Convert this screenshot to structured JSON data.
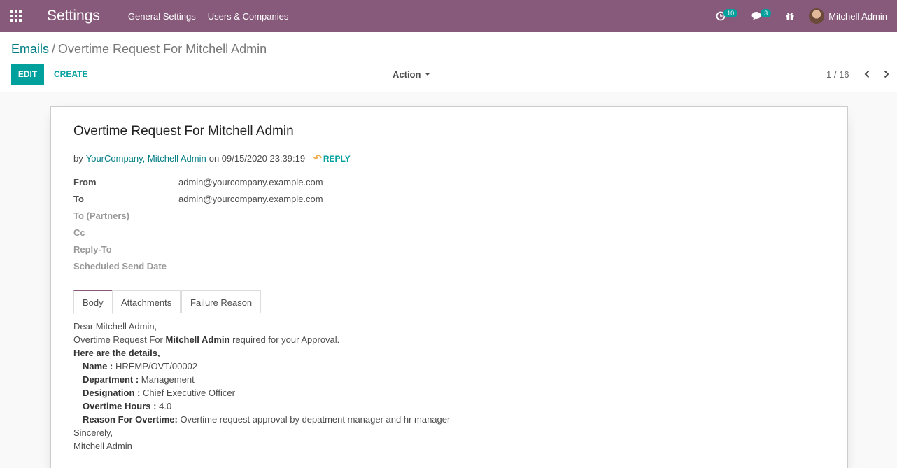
{
  "navbar": {
    "app_title": "Settings",
    "menu": [
      "General Settings",
      "Users & Companies"
    ],
    "activity_count": "10",
    "messages_count": "3",
    "user_name": "Mitchell Admin"
  },
  "breadcrumb": {
    "parent": "Emails",
    "separator": "/",
    "current": "Overtime Request For Mitchell Admin"
  },
  "toolbar": {
    "edit_label": "EDIT",
    "create_label": "CREATE",
    "action_label": "Action",
    "pager": "1 / 16"
  },
  "mail": {
    "subject": "Overtime Request For Mitchell Admin",
    "by_prefix": "by",
    "author": "YourCompany, Mitchell Admin",
    "on_text": "on 09/15/2020 23:39:19",
    "reply_label": "REPLY"
  },
  "fields": [
    {
      "label": "From",
      "value": "admin@yourcompany.example.com"
    },
    {
      "label": "To",
      "value": "admin@yourcompany.example.com"
    },
    {
      "label": "To (Partners)",
      "value": ""
    },
    {
      "label": "Cc",
      "value": ""
    },
    {
      "label": "Reply-To",
      "value": ""
    },
    {
      "label": "Scheduled Send Date",
      "value": ""
    }
  ],
  "tabs": [
    "Body",
    "Attachments",
    "Failure Reason"
  ],
  "body": {
    "greeting": "Dear Mitchell Admin,",
    "line1_pre": "Overtime Request For ",
    "line1_bold": "Mitchell Admin",
    "line1_post": " required for your Approval.",
    "details_heading": "Here are the details,",
    "details": [
      {
        "label": "Name :",
        "value": " HREMP/OVT/00002"
      },
      {
        "label": "Department :",
        "value": " Management"
      },
      {
        "label": "Designation :",
        "value": " Chief Executive Officer"
      },
      {
        "label": "Overtime Hours :",
        "value": " 4.0"
      },
      {
        "label": "Reason For Overtime:",
        "value": " Overtime request approval by depatment manager and hr manager"
      }
    ],
    "closing": "Sincerely,",
    "signature": "Mitchell Admin"
  },
  "colors": {
    "navbar": "#875a7b",
    "accent": "#00a09d",
    "link": "#017e84"
  }
}
